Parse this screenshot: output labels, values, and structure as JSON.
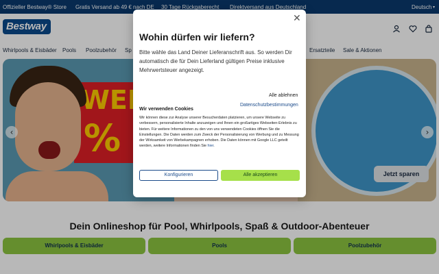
{
  "topbar": {
    "official_store": "Offizieller Bestway® Store",
    "shipping": "Gratis Versand ab 49 € nach DE",
    "returns": "30 Tage Rückgaberecht",
    "direct": "Direktversand aus Deutschland",
    "language": "Deutsch"
  },
  "header": {
    "logo_text": "Bestway",
    "icons": [
      "user-icon",
      "heart-icon",
      "cart-icon"
    ]
  },
  "nav": {
    "items": [
      "Whirlpools & Eisbäder",
      "Pools",
      "Poolzubehör",
      "Sp",
      "Ersatzteile",
      "Sale & Aktionen"
    ]
  },
  "hero": {
    "sign_text": "WEN",
    "sign_percent": "%",
    "cta_label": "Jetzt sparen",
    "prev_arrow": "‹",
    "next_arrow": "›"
  },
  "section": {
    "title": "Dein Onlineshop für Pool, Whirlpools, Spaß & Outdoor-Abenteuer",
    "categories": [
      "Whirlpools & Eisbäder",
      "Pools",
      "Poolzubehör"
    ]
  },
  "modal": {
    "close_label": "✕",
    "title": "Wohin dürfen wir liefern?",
    "description": "Bitte wähle das Land Deiner Lieferanschrift aus. So werden Dir automatisch die für Dein Lieferland gültigen Preise inklusive Mehrwertsteuer angezeigt."
  },
  "cookie": {
    "decline_label": "Alle ablehnen",
    "privacy_label": "Datenschutzbestimmungen",
    "heading": "Wir verwenden Cookies",
    "text": "Wir können diese zur Analyse unserer Besucherdaten platzieren, um unsere Webseite zu verbessern, personalisierte Inhalte anzuzeigen und Ihnen ein großartiges Webseiten-Erlebnis zu bieten. Für weitere Informationen zu den von uns verwendeten Cookies öffnen Sie die Einstellungen. Die Daten werden zum Zweck der Personalisierung von Werbung und zu Messung der Wirksamkeit von Werbekampagnen erhoben. Die Daten können mit Google LLC geteilt werden, weitere Informationen finden Sie",
    "link_text": "hier",
    "configure_label": "Konfigurieren",
    "accept_label": "Alle akzeptieren"
  },
  "colors": {
    "topbar_bg": "#0b3a6e",
    "brand_blue": "#0a4a8c",
    "accent_green": "#8cc540",
    "accept_green": "#a6e04a"
  }
}
